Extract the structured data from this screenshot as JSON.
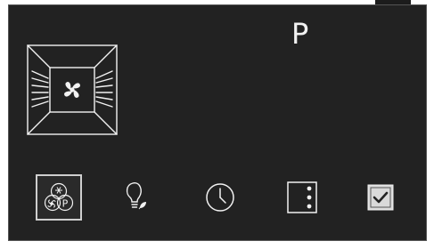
{
  "display": {
    "program_letter": "P"
  },
  "colors": {
    "background": "#222222",
    "foreground": "#f2f2f2",
    "confirm_fill": "#d9d9d9"
  },
  "oven_status": {
    "icon": "oven-fan-heating-icon"
  },
  "bottom_bar": {
    "buttons": [
      {
        "icon": "fan-defrost-program-icon",
        "selected": true
      },
      {
        "icon": "eco-light-bulb-icon",
        "selected": false
      },
      {
        "icon": "clock-timer-icon",
        "selected": false
      },
      {
        "icon": "more-options-icon",
        "selected": false
      },
      {
        "icon": "confirm-checkbox-icon",
        "selected": false
      }
    ]
  }
}
